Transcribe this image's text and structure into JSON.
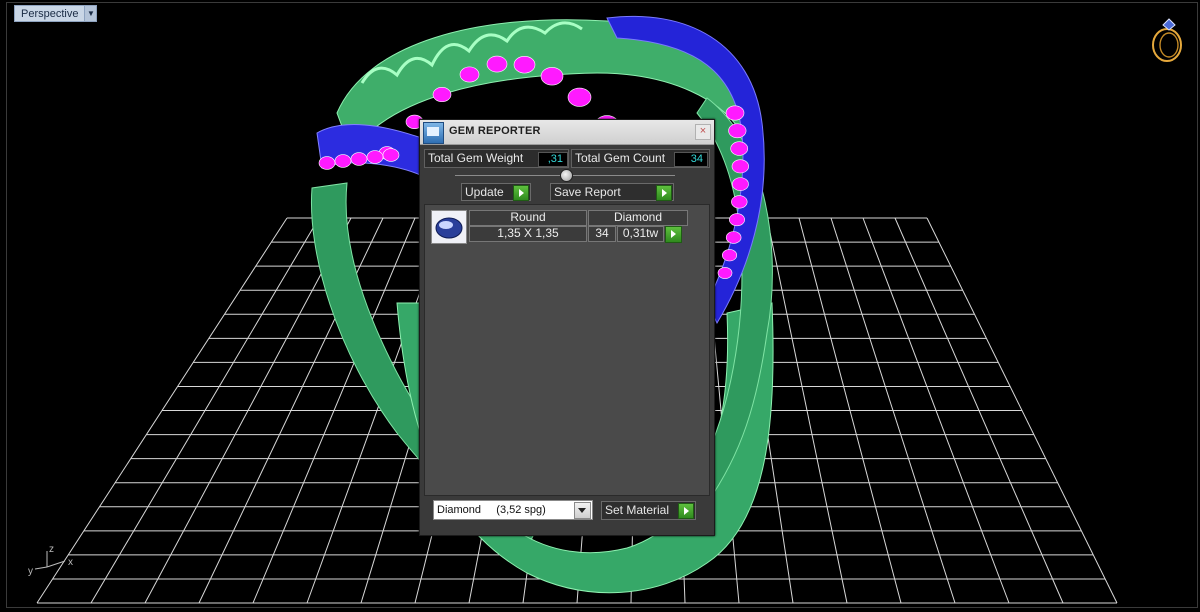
{
  "viewport": {
    "name": "Perspective",
    "axis_labels": {
      "x": "x",
      "y": "y",
      "z": "z"
    },
    "colors": {
      "background": "#000000",
      "grid": "#d8d8d8",
      "ring_body": "#3fbf73",
      "ring_edge": "#2020e0",
      "gems": "#ff00ff"
    },
    "icons": [
      "dropdown-arrow-icon",
      "ring-icon",
      "axes-icon"
    ]
  },
  "dialog": {
    "title": "GEM REPORTER",
    "close_label": "×",
    "total_weight_label": "Total Gem Weight",
    "total_weight_value": ",31",
    "total_count_label": "Total Gem Count",
    "total_count_value": "34",
    "update_label": "Update",
    "save_report_label": "Save Report",
    "gem_row": {
      "shape": "Round",
      "material": "Diamond",
      "size": "1,35 X 1,35",
      "count": "34",
      "weight": "0,31tw"
    },
    "material_select": "Diamond     (3,52 spg)",
    "set_material_label": "Set Material"
  }
}
